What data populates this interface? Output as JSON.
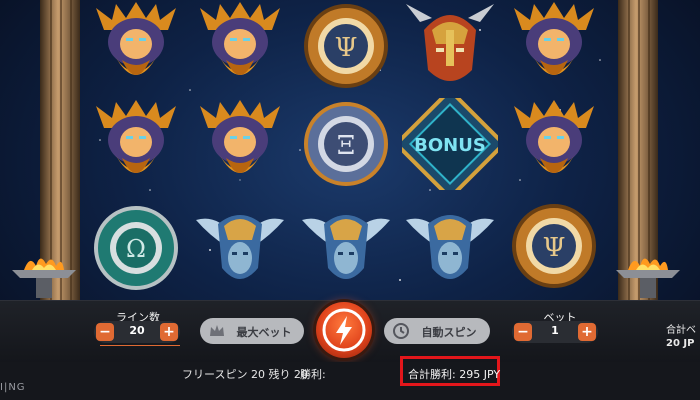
{
  "game": {
    "reels": [
      [
        "zeus",
        "zeus",
        "omega-shield"
      ],
      [
        "zeus",
        "zeus",
        "winged-helmet"
      ],
      [
        "psi-shield",
        "xi-shield",
        "winged-helmet"
      ],
      [
        "viking-helmet",
        "bonus",
        "winged-helmet"
      ],
      [
        "zeus",
        "zeus",
        "psi-shield"
      ]
    ],
    "bonus_text": "BONUS"
  },
  "controls": {
    "lines_label": "ライン数",
    "lines_value": "20",
    "max_bet_label": "最大ベット",
    "autospin_label": "自動スピン",
    "bet_label": "ベット",
    "bet_value": "1",
    "minus": "−",
    "plus": "+",
    "total_bet_label": "合計ベ",
    "total_bet_value": "20 JP"
  },
  "info": {
    "brand": "I|NG",
    "free_spins": "フリースピン 20 残り 20",
    "win_label": "勝利:",
    "total_win": "合計勝利: 295 JPY"
  },
  "colors": {
    "accent": "#e06a33",
    "highlight": "#e3161b"
  }
}
